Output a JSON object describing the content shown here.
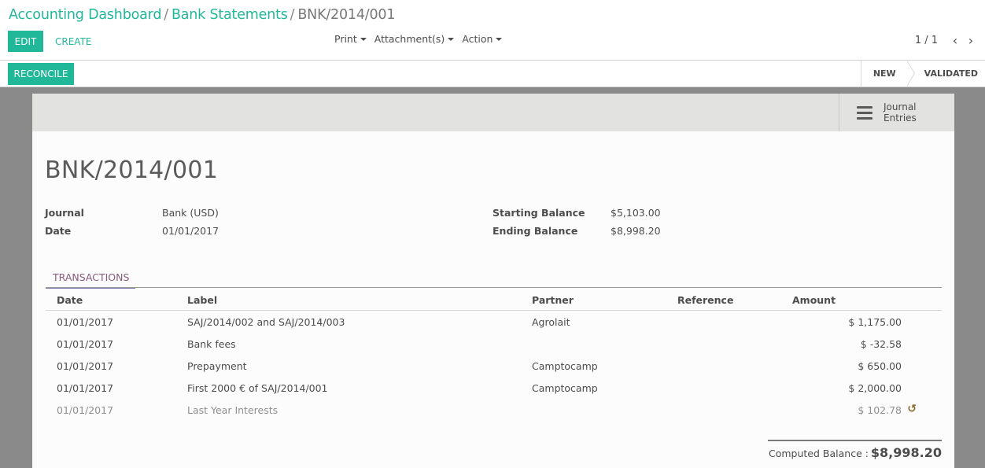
{
  "breadcrumb": {
    "items": [
      "Accounting Dashboard",
      "Bank Statements"
    ],
    "separator": "/",
    "current": "BNK/2014/001"
  },
  "buttons": {
    "edit": "EDIT",
    "create": "CREATE",
    "reconcile": "RECONCILE",
    "journal_entries_line1": "Journal",
    "journal_entries_line2": "Entries"
  },
  "menus": [
    "Print",
    "Attachment(s)",
    "Action"
  ],
  "pager": {
    "value": "1 / 1",
    "prev": "‹",
    "next": "›"
  },
  "stages": [
    {
      "label": "NEW",
      "active": false
    },
    {
      "label": "VALIDATED",
      "active": false
    }
  ],
  "record": {
    "title": "BNK/2014/001",
    "journal_label": "Journal",
    "journal": "Bank (USD)",
    "date_label": "Date",
    "date": "01/01/2017",
    "starting_balance_label": "Starting Balance",
    "starting_balance": "$5,103.00",
    "ending_balance_label": "Ending Balance",
    "ending_balance": "$8,998.20"
  },
  "tabs": {
    "transactions": "TRANSACTIONS"
  },
  "transactions": {
    "columns": {
      "date": "Date",
      "label": "Label",
      "partner": "Partner",
      "reference": "Reference",
      "amount": "Amount"
    },
    "rows": [
      {
        "date": "01/01/2017",
        "label": "SAJ/2014/002 and SAJ/2014/003",
        "partner": "Agrolait",
        "reference": "",
        "amount": "$ 1,175.00",
        "reconciled": false
      },
      {
        "date": "01/01/2017",
        "label": "Bank fees",
        "partner": "",
        "reference": "",
        "amount": "$ -32.58",
        "reconciled": false
      },
      {
        "date": "01/01/2017",
        "label": "Prepayment",
        "partner": "Camptocamp",
        "reference": "",
        "amount": "$ 650.00",
        "reconciled": false
      },
      {
        "date": "01/01/2017",
        "label": "First 2000 € of SAJ/2014/001",
        "partner": "Camptocamp",
        "reference": "",
        "amount": "$ 2,000.00",
        "reconciled": false
      },
      {
        "date": "01/01/2017",
        "label": "Last Year Interests",
        "partner": "",
        "reference": "",
        "amount": "$ 102.78",
        "reconciled": true
      }
    ]
  },
  "computed_balance": {
    "label": "Computed Balance :",
    "value": "$8,998.20"
  },
  "icons": {
    "journal_entries": "hamburger-menu-icon",
    "pager_prev": "chevron-left-icon",
    "pager_next": "chevron-right-icon",
    "reconciled": "undo-reconcile-icon"
  },
  "colors": {
    "primary": "#21b799",
    "tab_accent": "#875a7b",
    "sheet_background": "#8a8a8a",
    "muted_text": "#8f8f8f"
  }
}
